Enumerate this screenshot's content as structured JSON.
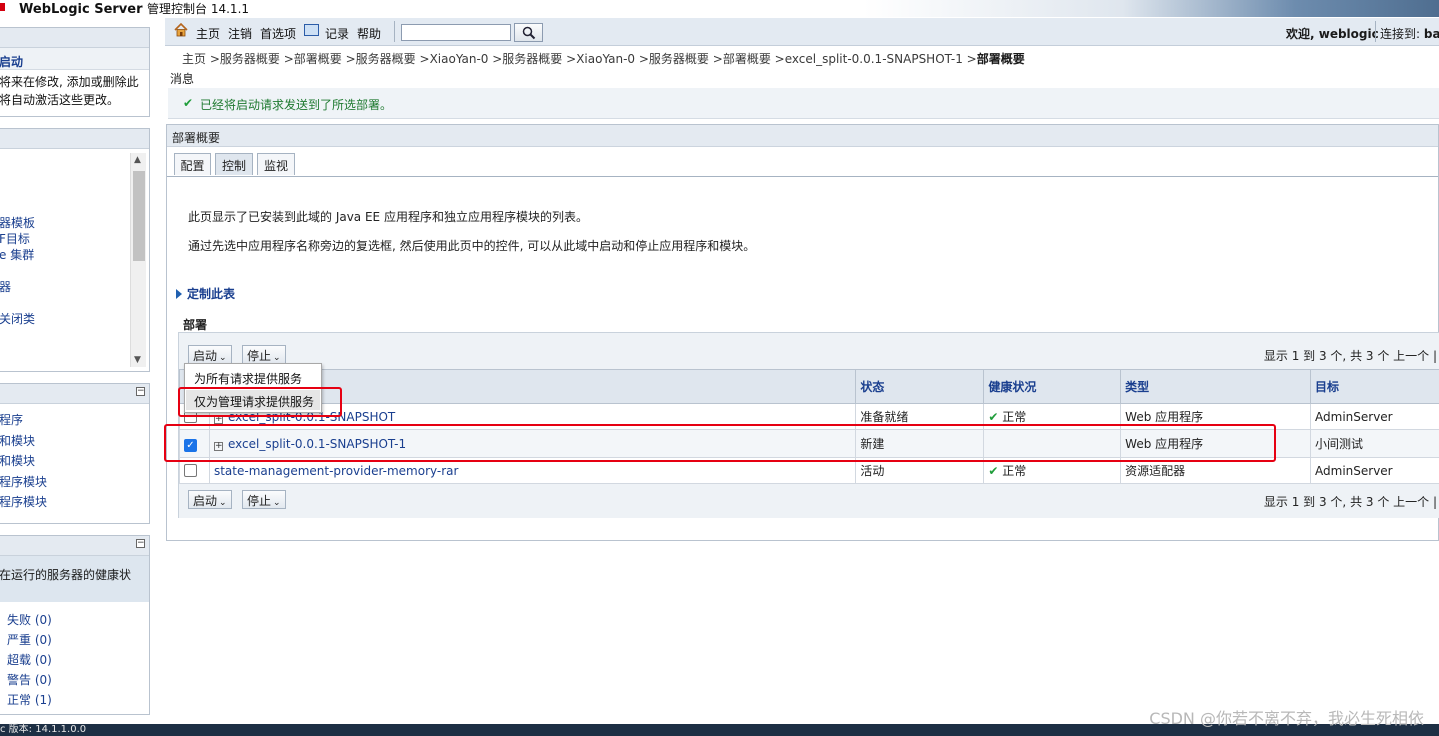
{
  "app": {
    "title": "WebLogic Server",
    "subtitle": "管理控制台 14.1.1"
  },
  "left": {
    "change_center": {
      "start_label": "启动",
      "text_line1": "将来在修改, 添加或删除此",
      "text_line2": "将自动激活这些更改。"
    },
    "domain_tree": {
      "items": [
        "器模板",
        "F目标",
        "e 集群",
        "",
        "器",
        "",
        "关闭类"
      ]
    },
    "how_do_i": {
      "items": [
        "程序",
        "和模块",
        "和模块",
        "程序模块",
        "程序模块"
      ]
    },
    "system_status": {
      "desc": "在运行的服务器的健康状",
      "health": [
        {
          "label": "失败 (0)"
        },
        {
          "label": "严重 (0)"
        },
        {
          "label": "超载 (0)"
        },
        {
          "label": "警告 (0)"
        },
        {
          "label": "正常 (1)"
        }
      ]
    }
  },
  "toolbar": {
    "home": "主页",
    "logout": "注销",
    "preferences": "首选项",
    "record": "记录",
    "help": "帮助",
    "search_value": "",
    "welcome": "欢迎, weblogic",
    "connected_label": "连接到:",
    "connected_value": "ba"
  },
  "breadcrumb": {
    "items": [
      "主页",
      ">服务器概要",
      ">部署概要",
      ">服务器概要",
      ">XiaoYan-0",
      ">服务器概要",
      ">XiaoYan-0",
      ">服务器概要",
      ">部署概要",
      ">excel_split-0.0.1-SNAPSHOT-1",
      ">"
    ],
    "current": "部署概要"
  },
  "messages": {
    "title": "消息",
    "success": "已经将启动请求发送到了所选部署。"
  },
  "main": {
    "title": "部署概要",
    "tabs": [
      {
        "label": "配置"
      },
      {
        "label": "控制"
      },
      {
        "label": "监视"
      }
    ],
    "desc1": "此页显示了已安装到此域的 Java EE 应用程序和独立应用程序模块的列表。",
    "desc2": "通过先选中应用程序名称旁边的复选框, 然后使用此页中的控件, 可以从此域中启动和停止应用程序和模块。",
    "customize": "定制此表",
    "section_title": "部署",
    "start_button": "启动",
    "stop_button": "停止",
    "pager": "显示 1 到 3 个, 共 3 个   上一个 |",
    "columns": {
      "name": "",
      "state": "状态",
      "health": "健康状况",
      "type": "类型",
      "targets": "目标"
    },
    "rows": [
      {
        "name": "excel_split-0.0.1-SNAPSHOT",
        "state": "准备就绪",
        "health": "正常",
        "type": "Web 应用程序",
        "targets": "AdminServer"
      },
      {
        "name": "excel_split-0.0.1-SNAPSHOT-1",
        "state": "新建",
        "health": "",
        "type": "Web 应用程序",
        "targets": "小间测试"
      },
      {
        "name": "state-management-provider-memory-rar",
        "state": "活动",
        "health": "正常",
        "type": "资源适配器",
        "targets": "AdminServer"
      }
    ],
    "start_menu": {
      "all_requests": "为所有请求提供服务",
      "admin_requests": "仅为管理请求提供服务"
    }
  },
  "footer": {
    "version": "c 版本: 14.1.1.0.0"
  },
  "watermark": "CSDN @你若不离不弃，我必生死相依",
  "colors": {
    "accent": "#1a3f8f",
    "success": "#1f9d3a",
    "annotation": "#e60012"
  }
}
